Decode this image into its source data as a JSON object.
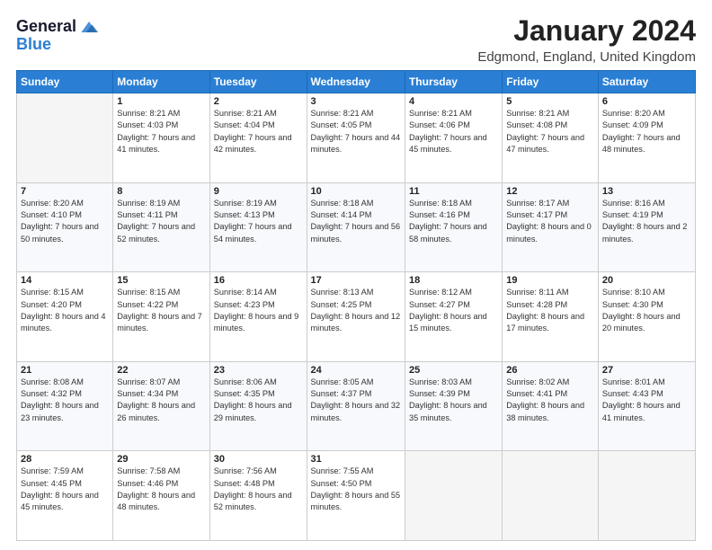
{
  "header": {
    "logo_line1": "General",
    "logo_line2": "Blue",
    "title": "January 2024",
    "subtitle": "Edgmond, England, United Kingdom"
  },
  "weekdays": [
    "Sunday",
    "Monday",
    "Tuesday",
    "Wednesday",
    "Thursday",
    "Friday",
    "Saturday"
  ],
  "weeks": [
    [
      {
        "day": "",
        "empty": true
      },
      {
        "day": "1",
        "rise": "8:21 AM",
        "set": "4:03 PM",
        "daylight": "7 hours and 41 minutes."
      },
      {
        "day": "2",
        "rise": "8:21 AM",
        "set": "4:04 PM",
        "daylight": "7 hours and 42 minutes."
      },
      {
        "day": "3",
        "rise": "8:21 AM",
        "set": "4:05 PM",
        "daylight": "7 hours and 44 minutes."
      },
      {
        "day": "4",
        "rise": "8:21 AM",
        "set": "4:06 PM",
        "daylight": "7 hours and 45 minutes."
      },
      {
        "day": "5",
        "rise": "8:21 AM",
        "set": "4:08 PM",
        "daylight": "7 hours and 47 minutes."
      },
      {
        "day": "6",
        "rise": "8:20 AM",
        "set": "4:09 PM",
        "daylight": "7 hours and 48 minutes."
      }
    ],
    [
      {
        "day": "7",
        "rise": "8:20 AM",
        "set": "4:10 PM",
        "daylight": "7 hours and 50 minutes."
      },
      {
        "day": "8",
        "rise": "8:19 AM",
        "set": "4:11 PM",
        "daylight": "7 hours and 52 minutes."
      },
      {
        "day": "9",
        "rise": "8:19 AM",
        "set": "4:13 PM",
        "daylight": "7 hours and 54 minutes."
      },
      {
        "day": "10",
        "rise": "8:18 AM",
        "set": "4:14 PM",
        "daylight": "7 hours and 56 minutes."
      },
      {
        "day": "11",
        "rise": "8:18 AM",
        "set": "4:16 PM",
        "daylight": "7 hours and 58 minutes."
      },
      {
        "day": "12",
        "rise": "8:17 AM",
        "set": "4:17 PM",
        "daylight": "8 hours and 0 minutes."
      },
      {
        "day": "13",
        "rise": "8:16 AM",
        "set": "4:19 PM",
        "daylight": "8 hours and 2 minutes."
      }
    ],
    [
      {
        "day": "14",
        "rise": "8:15 AM",
        "set": "4:20 PM",
        "daylight": "8 hours and 4 minutes."
      },
      {
        "day": "15",
        "rise": "8:15 AM",
        "set": "4:22 PM",
        "daylight": "8 hours and 7 minutes."
      },
      {
        "day": "16",
        "rise": "8:14 AM",
        "set": "4:23 PM",
        "daylight": "8 hours and 9 minutes."
      },
      {
        "day": "17",
        "rise": "8:13 AM",
        "set": "4:25 PM",
        "daylight": "8 hours and 12 minutes."
      },
      {
        "day": "18",
        "rise": "8:12 AM",
        "set": "4:27 PM",
        "daylight": "8 hours and 15 minutes."
      },
      {
        "day": "19",
        "rise": "8:11 AM",
        "set": "4:28 PM",
        "daylight": "8 hours and 17 minutes."
      },
      {
        "day": "20",
        "rise": "8:10 AM",
        "set": "4:30 PM",
        "daylight": "8 hours and 20 minutes."
      }
    ],
    [
      {
        "day": "21",
        "rise": "8:08 AM",
        "set": "4:32 PM",
        "daylight": "8 hours and 23 minutes."
      },
      {
        "day": "22",
        "rise": "8:07 AM",
        "set": "4:34 PM",
        "daylight": "8 hours and 26 minutes."
      },
      {
        "day": "23",
        "rise": "8:06 AM",
        "set": "4:35 PM",
        "daylight": "8 hours and 29 minutes."
      },
      {
        "day": "24",
        "rise": "8:05 AM",
        "set": "4:37 PM",
        "daylight": "8 hours and 32 minutes."
      },
      {
        "day": "25",
        "rise": "8:03 AM",
        "set": "4:39 PM",
        "daylight": "8 hours and 35 minutes."
      },
      {
        "day": "26",
        "rise": "8:02 AM",
        "set": "4:41 PM",
        "daylight": "8 hours and 38 minutes."
      },
      {
        "day": "27",
        "rise": "8:01 AM",
        "set": "4:43 PM",
        "daylight": "8 hours and 41 minutes."
      }
    ],
    [
      {
        "day": "28",
        "rise": "7:59 AM",
        "set": "4:45 PM",
        "daylight": "8 hours and 45 minutes."
      },
      {
        "day": "29",
        "rise": "7:58 AM",
        "set": "4:46 PM",
        "daylight": "8 hours and 48 minutes."
      },
      {
        "day": "30",
        "rise": "7:56 AM",
        "set": "4:48 PM",
        "daylight": "8 hours and 52 minutes."
      },
      {
        "day": "31",
        "rise": "7:55 AM",
        "set": "4:50 PM",
        "daylight": "8 hours and 55 minutes."
      },
      {
        "day": "",
        "empty": true
      },
      {
        "day": "",
        "empty": true
      },
      {
        "day": "",
        "empty": true
      }
    ]
  ]
}
